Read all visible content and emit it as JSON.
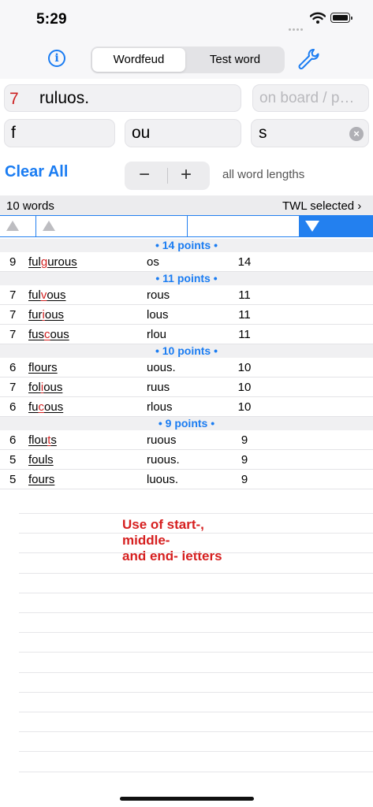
{
  "status": {
    "time": "5:29"
  },
  "toolbar": {
    "segments": [
      "Wordfeud",
      "Test word"
    ],
    "active_segment": "Wordfeud",
    "info_icon": "info-icon",
    "settings_icon": "wrench-icon"
  },
  "inputs": {
    "length": "7",
    "letters": "ruluos.",
    "board_placeholder": "on board / p…",
    "start": "f",
    "middle": "ou",
    "end": "s"
  },
  "controls": {
    "clear_all": "Clear All",
    "minus": "−",
    "plus": "+",
    "length_filter": "all word lengths"
  },
  "summary": {
    "count": "10 words",
    "dictionary": "TWL selected ›"
  },
  "groups": [
    {
      "label": "• 14 points •",
      "rows": [
        {
          "len": "9",
          "word": [
            [
              "ful",
              ""
            ],
            [
              "g",
              "red"
            ],
            [
              "ur",
              ""
            ],
            [
              "ous",
              ""
            ]
          ],
          "rest": "os",
          "pts": "14"
        }
      ]
    },
    {
      "label": "• 11 points •",
      "rows": [
        {
          "len": "7",
          "word": [
            [
              "ful",
              ""
            ],
            [
              "v",
              "red"
            ],
            [
              "ous",
              ""
            ]
          ],
          "rest": "rous",
          "pts": "11"
        },
        {
          "len": "7",
          "word": [
            [
              "fur",
              ""
            ],
            [
              "i",
              "red"
            ],
            [
              "ous",
              ""
            ]
          ],
          "rest": "lous",
          "pts": "11"
        },
        {
          "len": "7",
          "word": [
            [
              "fus",
              ""
            ],
            [
              "c",
              "red"
            ],
            [
              "ous",
              ""
            ]
          ],
          "rest": "rlou",
          "pts": "11"
        }
      ]
    },
    {
      "label": "• 10 points •",
      "rows": [
        {
          "len": "6",
          "word": [
            [
              "flours",
              ""
            ]
          ],
          "rest": "uous.",
          "pts": "10"
        },
        {
          "len": "7",
          "word": [
            [
              "fol",
              ""
            ],
            [
              "i",
              "red"
            ],
            [
              "ous",
              ""
            ]
          ],
          "rest": "ruus",
          "pts": "10"
        },
        {
          "len": "6",
          "word": [
            [
              "fu",
              ""
            ],
            [
              "c",
              "red"
            ],
            [
              "ous",
              ""
            ]
          ],
          "rest": "rlous",
          "pts": "10"
        }
      ]
    },
    {
      "label": "• 9 points •",
      "rows": [
        {
          "len": "6",
          "word": [
            [
              "flou",
              ""
            ],
            [
              "t",
              "red"
            ],
            [
              "s",
              ""
            ]
          ],
          "rest": "ruous",
          "pts": "9"
        },
        {
          "len": "5",
          "word": [
            [
              "fouls",
              ""
            ]
          ],
          "rest": "ruous.",
          "pts": "9"
        },
        {
          "len": "5",
          "word": [
            [
              "fours",
              ""
            ]
          ],
          "rest": "luous.",
          "pts": "9"
        }
      ]
    }
  ],
  "hint": "Use of start-,\nmiddle-\nand end- letters",
  "colors": {
    "accent": "#1a7cf2",
    "highlight": "#d21f1f"
  }
}
